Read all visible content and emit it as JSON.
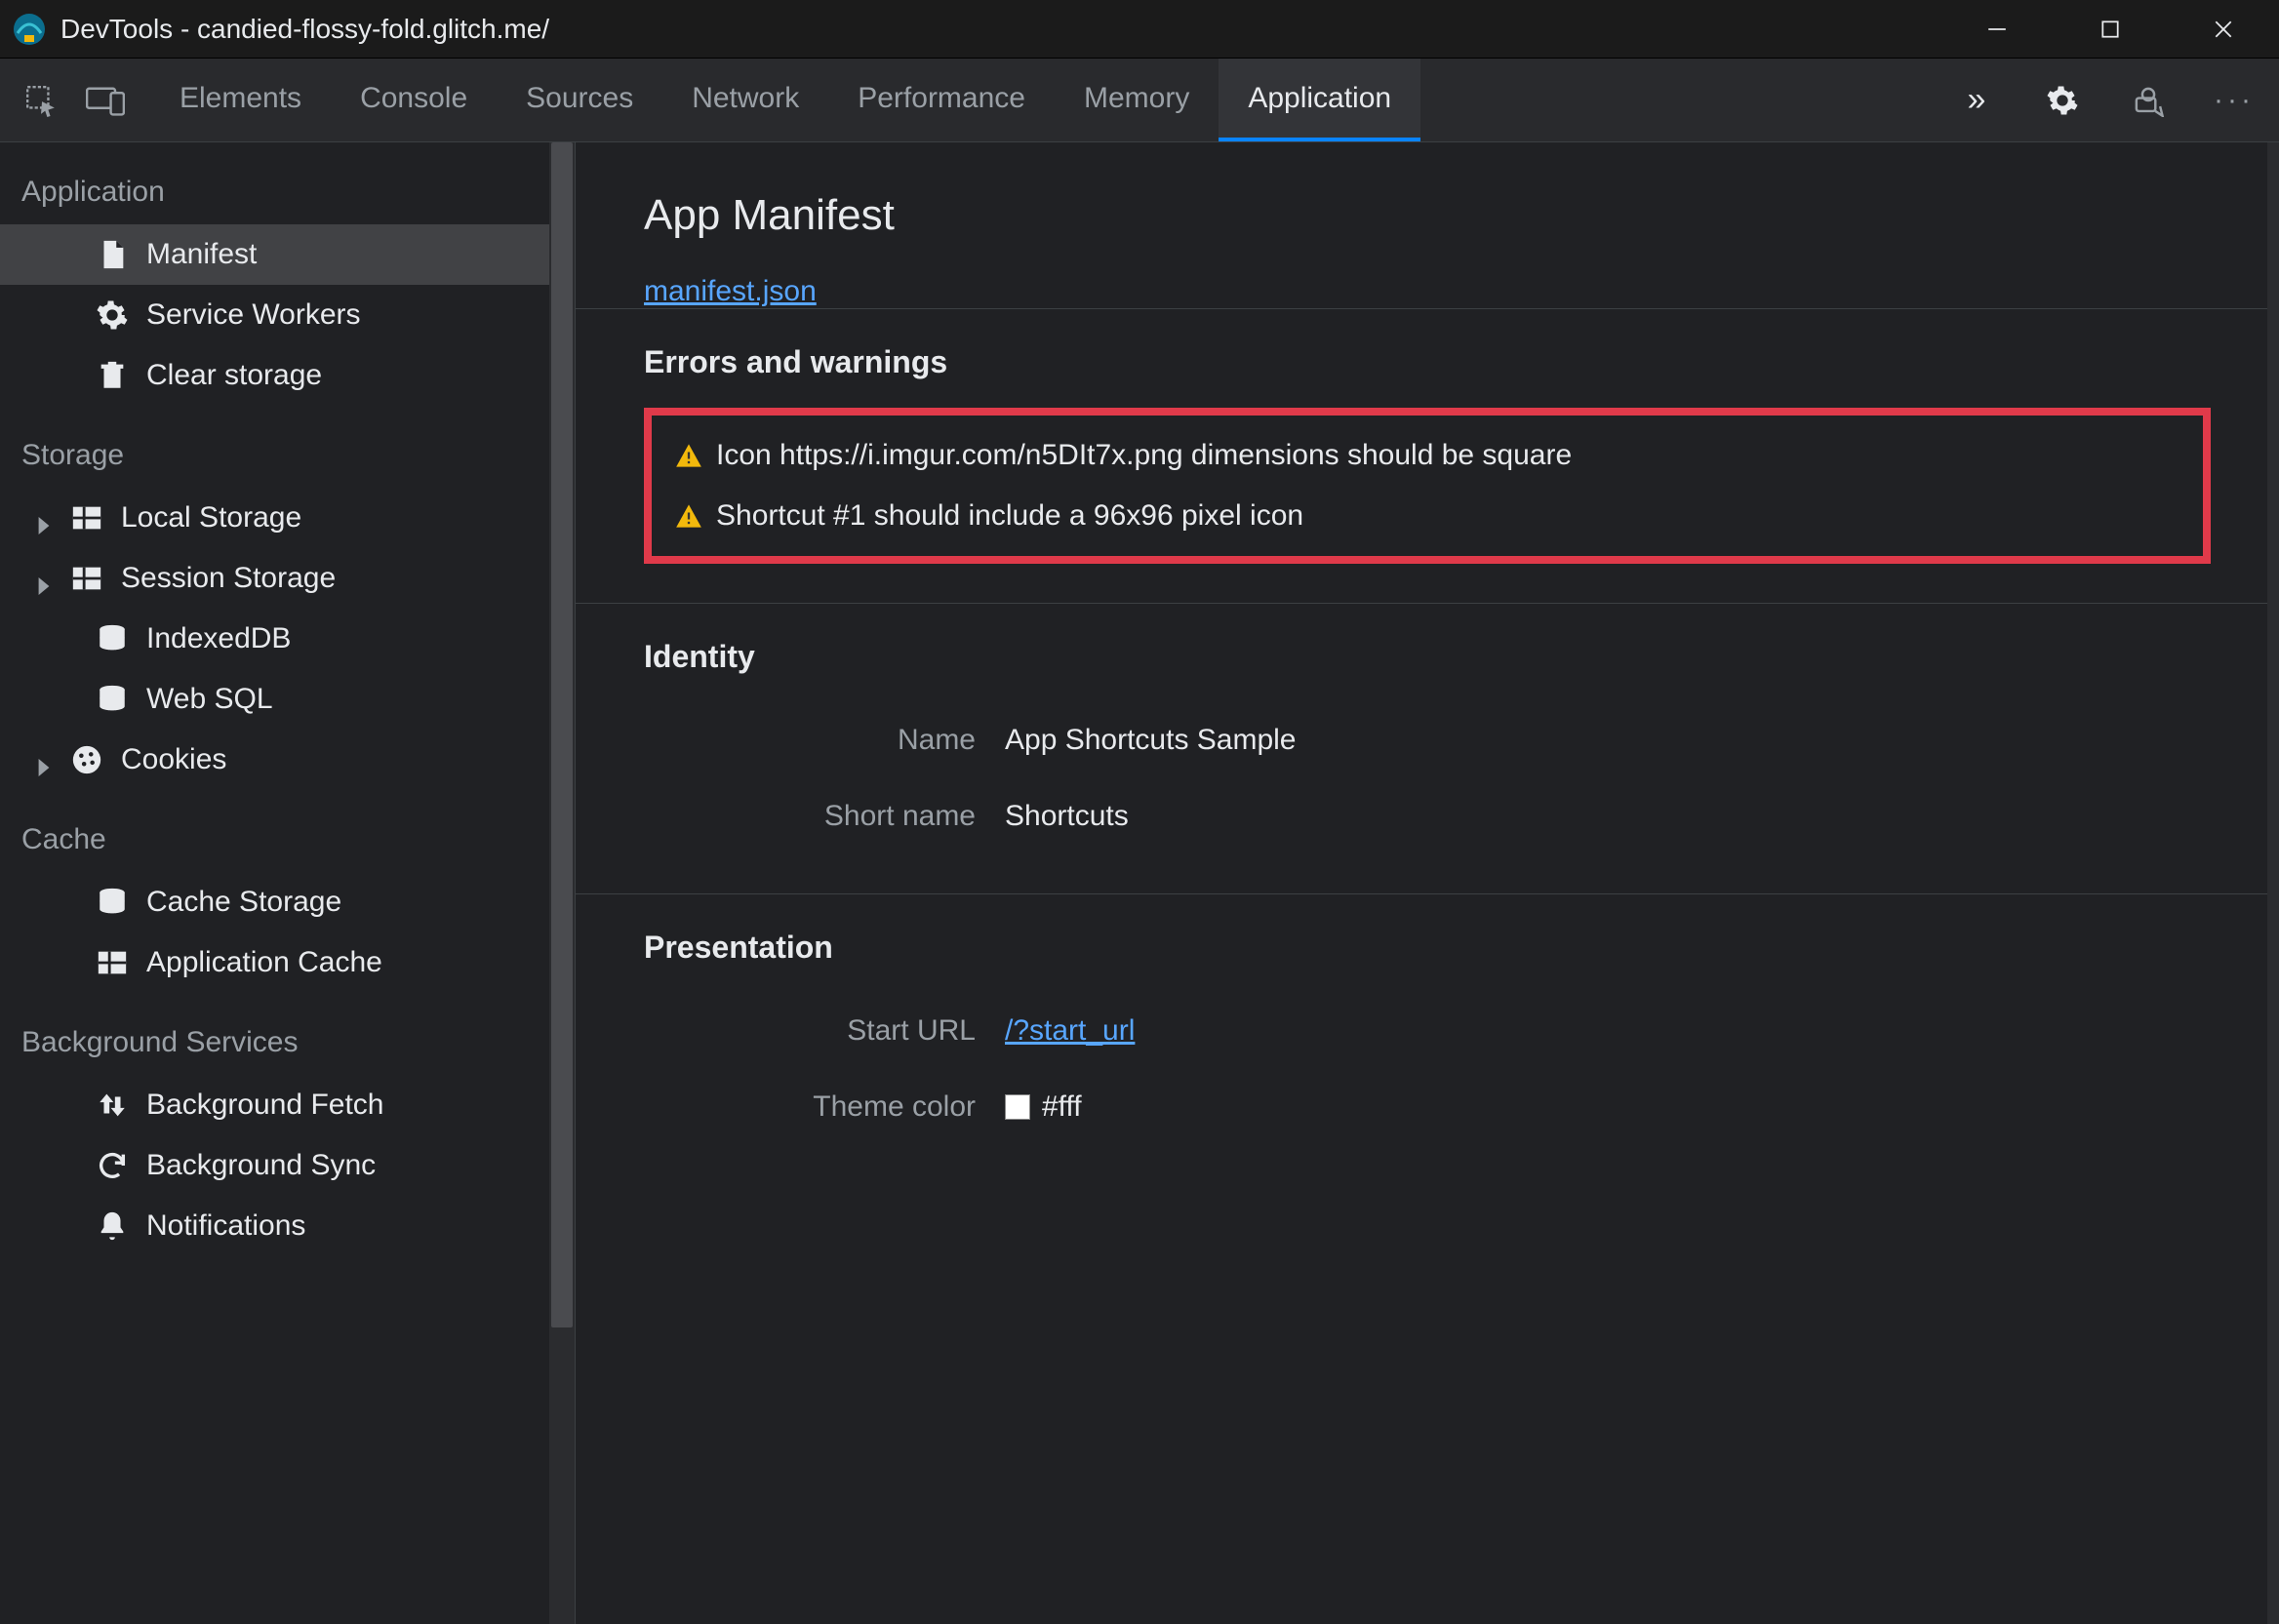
{
  "window": {
    "title": "DevTools - candied-flossy-fold.glitch.me/"
  },
  "tabs": {
    "items": [
      "Elements",
      "Console",
      "Sources",
      "Network",
      "Performance",
      "Memory",
      "Application"
    ],
    "active": "Application",
    "overflow": "»"
  },
  "sidebar": {
    "groups": [
      {
        "title": "Application",
        "items": [
          {
            "icon": "file",
            "label": "Manifest",
            "selected": true
          },
          {
            "icon": "gear",
            "label": "Service Workers"
          },
          {
            "icon": "trash",
            "label": "Clear storage"
          }
        ]
      },
      {
        "title": "Storage",
        "items": [
          {
            "icon": "grid",
            "label": "Local Storage",
            "caret": true
          },
          {
            "icon": "grid",
            "label": "Session Storage",
            "caret": true
          },
          {
            "icon": "db",
            "label": "IndexedDB"
          },
          {
            "icon": "db",
            "label": "Web SQL"
          },
          {
            "icon": "cookie",
            "label": "Cookies",
            "caret": true
          }
        ]
      },
      {
        "title": "Cache",
        "items": [
          {
            "icon": "db",
            "label": "Cache Storage"
          },
          {
            "icon": "grid",
            "label": "Application Cache"
          }
        ]
      },
      {
        "title": "Background Services",
        "items": [
          {
            "icon": "updown",
            "label": "Background Fetch"
          },
          {
            "icon": "sync",
            "label": "Background Sync"
          },
          {
            "icon": "bell",
            "label": "Notifications"
          }
        ]
      }
    ]
  },
  "manifest": {
    "title": "App Manifest",
    "file_link": "manifest.json",
    "errors_title": "Errors and warnings",
    "warnings": [
      "Icon https://i.imgur.com/n5DIt7x.png dimensions should be square",
      "Shortcut #1 should include a 96x96 pixel icon"
    ],
    "identity_title": "Identity",
    "identity": {
      "name_label": "Name",
      "name_value": "App Shortcuts Sample",
      "short_name_label": "Short name",
      "short_name_value": "Shortcuts"
    },
    "presentation_title": "Presentation",
    "presentation": {
      "start_url_label": "Start URL",
      "start_url_value": "/?start_url",
      "theme_color_label": "Theme color",
      "theme_color_value": "#fff"
    }
  }
}
